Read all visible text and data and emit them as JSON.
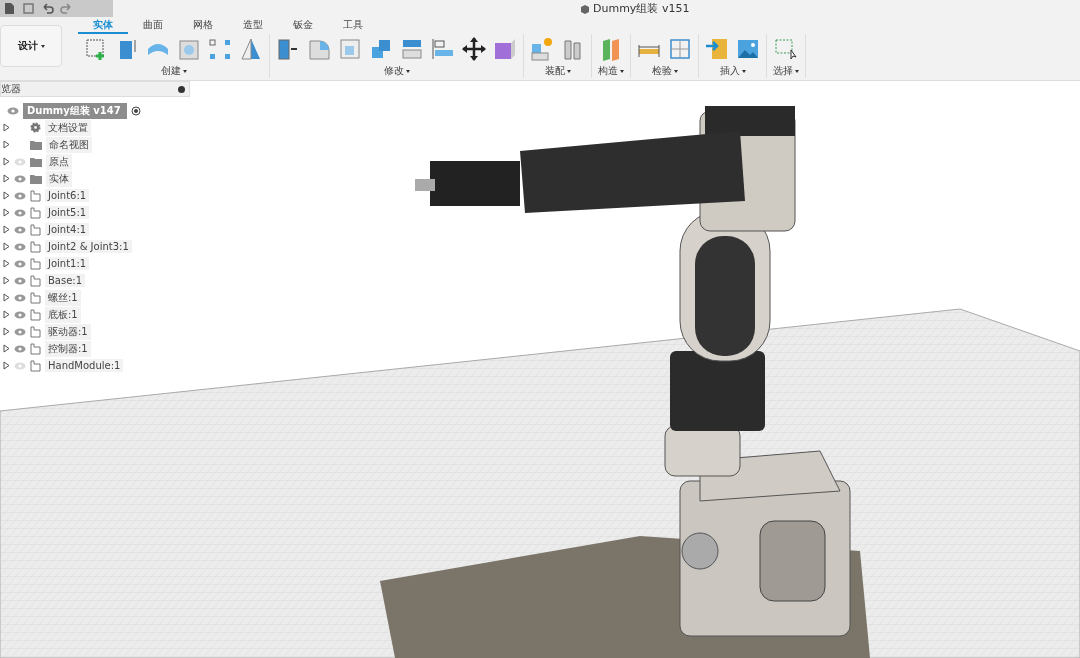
{
  "window": {
    "title": "Dummy组装 v151"
  },
  "workspace": {
    "label": "设计"
  },
  "tabs": [
    {
      "label": "实体",
      "selected": true
    },
    {
      "label": "曲面",
      "selected": false
    },
    {
      "label": "网格",
      "selected": false
    },
    {
      "label": "造型",
      "selected": false
    },
    {
      "label": "钣金",
      "selected": false
    },
    {
      "label": "工具",
      "selected": false
    }
  ],
  "tool_groups": [
    {
      "label": "创建"
    },
    {
      "label": "修改"
    },
    {
      "label": "装配"
    },
    {
      "label": "构造"
    },
    {
      "label": "检验"
    },
    {
      "label": "插入"
    },
    {
      "label": "选择"
    }
  ],
  "browser": {
    "title": "览器",
    "root": {
      "label": "Dummy组装 v147",
      "visible": true
    },
    "items": [
      {
        "kind": "settings",
        "label": "文档设置"
      },
      {
        "kind": "folder",
        "label": "命名视图"
      },
      {
        "kind": "folder",
        "label": "原点",
        "visible": false
      },
      {
        "kind": "folder",
        "label": "实体",
        "visible": true
      },
      {
        "kind": "component",
        "label": "Joint6:1",
        "visible": true
      },
      {
        "kind": "component",
        "label": "Joint5:1",
        "visible": true
      },
      {
        "kind": "component",
        "label": "Joint4:1",
        "visible": true
      },
      {
        "kind": "component",
        "label": "Joint2 & Joint3:1",
        "visible": true
      },
      {
        "kind": "component",
        "label": "Joint1:1",
        "visible": true
      },
      {
        "kind": "component",
        "label": "Base:1",
        "visible": true
      },
      {
        "kind": "component",
        "label": "螺丝:1",
        "visible": true
      },
      {
        "kind": "component",
        "label": "底板:1",
        "visible": true
      },
      {
        "kind": "component",
        "label": "驱动器:1",
        "visible": true
      },
      {
        "kind": "component",
        "label": "控制器:1",
        "visible": true
      },
      {
        "kind": "component",
        "label": "HandModule:1",
        "visible": false
      }
    ]
  }
}
